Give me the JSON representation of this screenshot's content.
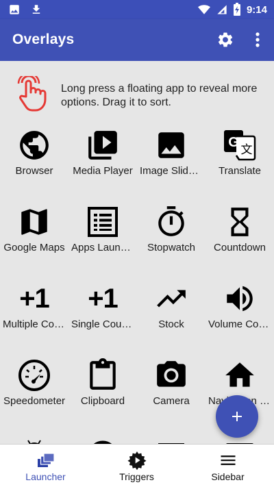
{
  "status_bar": {
    "time": "9:14"
  },
  "app_bar": {
    "title": "Overlays"
  },
  "hint": {
    "text": "Long press a floating app to reveal more options. Drag it to sort."
  },
  "apps": [
    {
      "label": "Browser",
      "icon": "globe-icon"
    },
    {
      "label": "Media Player",
      "icon": "media-player-icon"
    },
    {
      "label": "Image Slideshow",
      "icon": "image-icon"
    },
    {
      "label": "Translate",
      "icon": "translate-icon"
    },
    {
      "label": "Google Maps",
      "icon": "map-icon"
    },
    {
      "label": "Apps Launcher",
      "icon": "list-icon"
    },
    {
      "label": "Stopwatch",
      "icon": "stopwatch-icon"
    },
    {
      "label": "Countdown",
      "icon": "hourglass-icon"
    },
    {
      "label": "Multiple Counters",
      "icon": "plus-one-icon",
      "glyph": "+1"
    },
    {
      "label": "Single Counter",
      "icon": "plus-one-icon",
      "glyph": "+1"
    },
    {
      "label": "Stock",
      "icon": "trending-icon"
    },
    {
      "label": "Volume Control",
      "icon": "volume-icon"
    },
    {
      "label": "Speedometer",
      "icon": "speedometer-icon"
    },
    {
      "label": "Clipboard",
      "icon": "clipboard-icon"
    },
    {
      "label": "Camera",
      "icon": "camera-icon"
    },
    {
      "label": "Navigation Bar",
      "icon": "home-icon"
    }
  ],
  "fab": {
    "icon": "add-icon"
  },
  "bottom_nav": [
    {
      "label": "Launcher",
      "icon": "layers-icon",
      "active": true
    },
    {
      "label": "Triggers",
      "icon": "trigger-icon",
      "active": false
    },
    {
      "label": "Sidebar",
      "icon": "menu-icon",
      "active": false
    }
  ],
  "colors": {
    "primary": "#3f51b5",
    "status": "#3c4fb8",
    "accent_red": "#e53935",
    "background": "#e6e6e6"
  }
}
